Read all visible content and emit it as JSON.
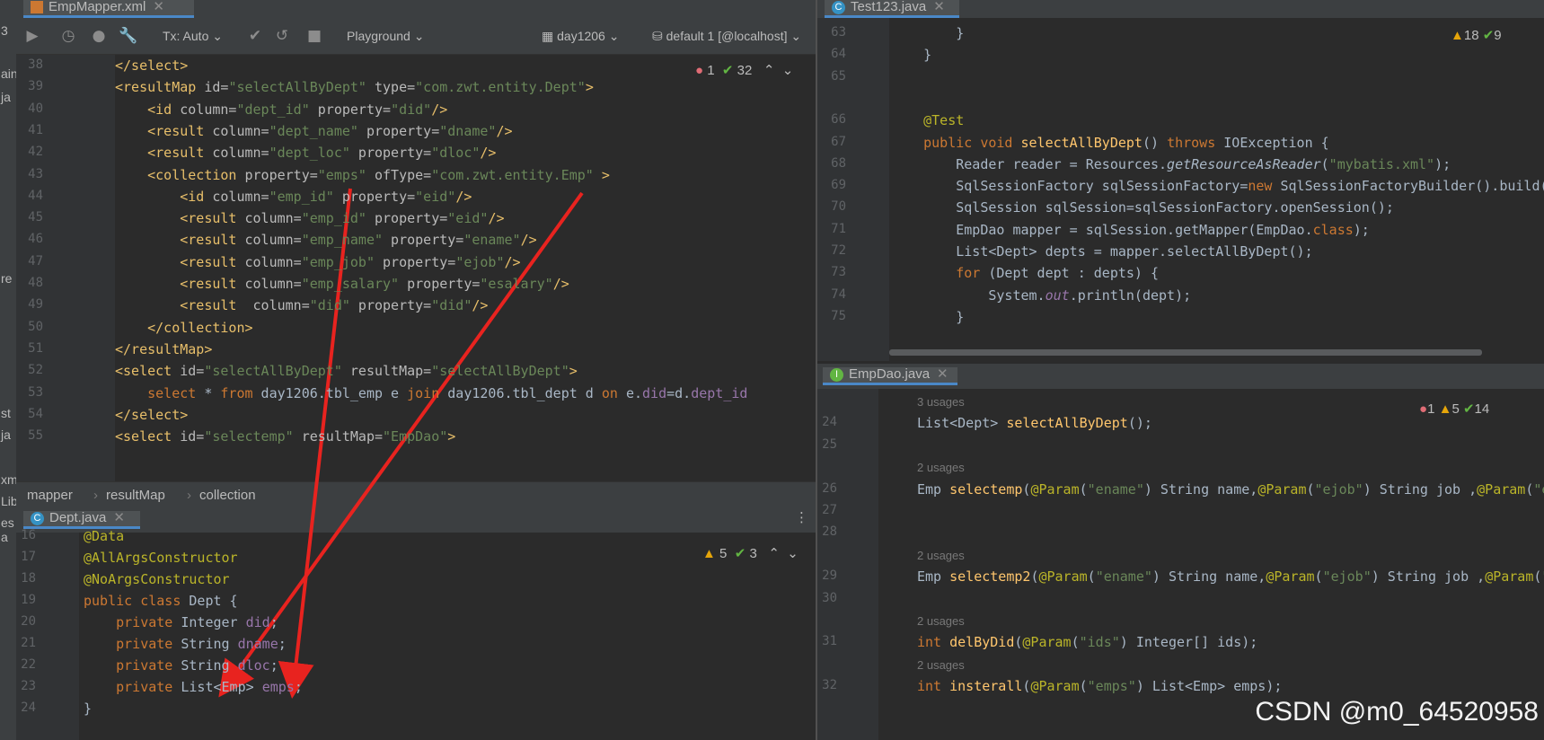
{
  "left_strip": {
    "fragments": [
      "3",
      "ain",
      "ja",
      "re",
      "st",
      "ja",
      "xm",
      "Lib",
      "es a"
    ]
  },
  "xml_editor": {
    "tab": {
      "label": "EmpMapper.xml"
    },
    "toolbar": {
      "tx": "Tx: Auto",
      "playground": "Playground",
      "schema": "day1206",
      "datasource": "default 1 [@localhost]"
    },
    "inspections": {
      "errors": "1",
      "ok": "32"
    },
    "lines": [
      {
        "n": "38",
        "html": "<span class='tag'>&lt;/select&gt;</span>"
      },
      {
        "n": "39",
        "html": "<span class='tag'>&lt;resultMap </span><span class='attr'>id=</span><span class='str'>\"selectAllByDept\"</span><span class='attr'> type=</span><span class='str'>\"com.zwt.entity.Dept\"</span><span class='tag'>&gt;</span>"
      },
      {
        "n": "40",
        "html": "    <span class='tag'>&lt;id </span><span class='attr'>column=</span><span class='str'>\"dept_id\"</span><span class='attr'> property=</span><span class='str'>\"did\"</span><span class='tag'>/&gt;</span>"
      },
      {
        "n": "41",
        "html": "    <span class='tag'>&lt;result </span><span class='attr'>column=</span><span class='str'>\"dept_name\"</span><span class='attr'> property=</span><span class='str'>\"dname\"</span><span class='tag'>/&gt;</span>"
      },
      {
        "n": "42",
        "html": "    <span class='tag'>&lt;result </span><span class='attr'>column=</span><span class='str'>\"dept_loc\"</span><span class='attr'> property=</span><span class='str'>\"dloc\"</span><span class='tag'>/&gt;</span>"
      },
      {
        "n": "43",
        "html": "    <span class='tag'>&lt;collection </span><span class='attr'>property=</span><span class='str'>\"emps\"</span><span class='attr'> ofType=</span><span class='str'>\"com.zwt.entity.Emp\"</span><span class='tag'> &gt;</span>"
      },
      {
        "n": "44",
        "html": "        <span class='tag'>&lt;id </span><span class='attr'>column=</span><span class='str'>\"emp_id\"</span><span class='attr'> property=</span><span class='str'>\"eid\"</span><span class='tag'>/&gt;</span>"
      },
      {
        "n": "45",
        "html": "        <span class='tag'>&lt;result </span><span class='attr'>column=</span><span class='str'>\"emp_id\"</span><span class='attr'> property=</span><span class='str'>\"eid\"</span><span class='tag'>/&gt;</span>"
      },
      {
        "n": "46",
        "html": "        <span class='tag'>&lt;result </span><span class='attr'>column=</span><span class='str'>\"emp_name\"</span><span class='attr'> property=</span><span class='str'>\"ename\"</span><span class='tag'>/&gt;</span>"
      },
      {
        "n": "47",
        "html": "        <span class='tag'>&lt;result </span><span class='attr'>column=</span><span class='str'>\"emp_job\"</span><span class='attr'> property=</span><span class='str'>\"ejob\"</span><span class='tag'>/&gt;</span>"
      },
      {
        "n": "48",
        "html": "        <span class='tag'>&lt;result </span><span class='attr'>column=</span><span class='str'>\"emp_salary\"</span><span class='attr'> property=</span><span class='str'>\"esalary\"</span><span class='tag'>/&gt;</span>"
      },
      {
        "n": "49",
        "html": "        <span class='tag'>&lt;result  </span><span class='attr'>column=</span><span class='str'>\"did\"</span><span class='attr'> property=</span><span class='str'>\"did\"</span><span class='tag'>/&gt;</span>"
      },
      {
        "n": "50",
        "html": "    <span class='tag'>&lt;/collection&gt;</span>"
      },
      {
        "n": "51",
        "html": "<span class='tag'>&lt;/resultMap&gt;</span>"
      },
      {
        "n": "52",
        "html": "<span class='tag'>&lt;select </span><span class='attr'>id=</span><span class='str'>\"selectAllByDept\"</span><span class='attr'> resultMap=</span><span class='str'>\"selectAllByDept\"</span><span class='tag'>&gt;</span>"
      },
      {
        "n": "53",
        "html": "    <span class='kw'>select</span> * <span class='kw'>from</span> day1206.tbl_emp e <span class='kw'>join</span> day1206.tbl_dept d <span class='kw'>on</span> e.<span class='fld'>did</span>=d.<span class='fld'>dept_id</span>"
      },
      {
        "n": "54",
        "html": "<span class='tag'>&lt;/select&gt;</span>"
      },
      {
        "n": "55",
        "html": "<span class='tag'>&lt;select </span><span class='attr'>id=</span><span class='str'>\"selectemp\"</span><span class='attr'> resultMap=</span><span class='str'>\"EmpDao\"</span><span class='tag'>&gt;</span>"
      }
    ],
    "breadcrumb": [
      "mapper",
      "resultMap",
      "collection"
    ]
  },
  "dept_editor": {
    "tab": {
      "label": "Dept.java"
    },
    "inspections": {
      "warnings": "5",
      "ok": "3"
    },
    "lines": [
      {
        "n": "16",
        "html": "<span class='anno'>@Data</span>"
      },
      {
        "n": "17",
        "html": "<span class='anno'>@AllArgsConstructor</span>"
      },
      {
        "n": "18",
        "html": "<span class='anno'>@NoArgsConstructor</span>"
      },
      {
        "n": "19",
        "html": "<span class='kw'>public class </span>Dept {"
      },
      {
        "n": "20",
        "html": "    <span class='kw'>private </span>Integer <span class='fld'>did</span>;"
      },
      {
        "n": "21",
        "html": "    <span class='kw'>private </span>String <span class='fld'>dname</span>;"
      },
      {
        "n": "22",
        "html": "    <span class='kw'>private </span>String <span class='fld'>dloc</span>;"
      },
      {
        "n": "23",
        "html": "    <span class='kw'>private </span>List&lt;Emp&gt; <span class='fld'>emps</span>;"
      },
      {
        "n": "24",
        "html": "}"
      }
    ]
  },
  "test_editor": {
    "tab": {
      "label": "Test123.java"
    },
    "inspections": {
      "warnings": "18",
      "ok": "9"
    },
    "lines": [
      {
        "n": "63",
        "html": "        }"
      },
      {
        "n": "64",
        "html": "    }"
      },
      {
        "n": "65",
        "html": ""
      },
      {
        "n": "",
        "html": ""
      },
      {
        "n": "66",
        "html": "    <span class='anno'>@Test</span>"
      },
      {
        "n": "67",
        "html": "    <span class='kw'>public void </span><span class='fn'>selectAllByDept</span>() <span class='kw'>throws </span>IOException {"
      },
      {
        "n": "68",
        "html": "        Reader reader = Resources.<i>getResourceAsReader</i>(<span class='str'>\"mybatis.xml\"</span>);"
      },
      {
        "n": "69",
        "html": "        SqlSessionFactory sqlSessionFactory=<span class='kw'>new </span>SqlSessionFactoryBuilder().build("
      },
      {
        "n": "70",
        "html": "        SqlSession sqlSession=sqlSessionFactory.openSession();"
      },
      {
        "n": "71",
        "html": "        EmpDao mapper = sqlSession.getMapper(EmpDao.<span class='kw'>class</span>);"
      },
      {
        "n": "72",
        "html": "        List&lt;Dept&gt; depts = mapper.selectAllByDept();"
      },
      {
        "n": "73",
        "html": "        <span class='kw'>for </span>(Dept dept : depts) {"
      },
      {
        "n": "74",
        "html": "            System.<i class='fld'>out</i>.println(dept);"
      },
      {
        "n": "75",
        "html": "        }"
      }
    ]
  },
  "empdao_editor": {
    "tab": {
      "label": "EmpDao.java"
    },
    "inspections": {
      "errors": "1",
      "warnings": "5",
      "ok": "14"
    },
    "lines": [
      {
        "n": "",
        "usage": "3 usages",
        "html": ""
      },
      {
        "n": "24",
        "usage": "",
        "html": "List&lt;Dept&gt; <span class='fn'>selectAllByDept</span>();"
      },
      {
        "n": "25",
        "usage": "",
        "html": ""
      },
      {
        "n": "",
        "usage": "2 usages",
        "html": ""
      },
      {
        "n": "26",
        "usage": "",
        "html": "Emp <span class='fn'>selectemp</span>(<span class='anno'>@Param</span>(<span class='str'>\"ename\"</span>) String name,<span class='anno'>@Param</span>(<span class='str'>\"ejob\"</span>) String job ,<span class='anno'>@Param</span>(<span class='str'>\"e</span>"
      },
      {
        "n": "27",
        "usage": "",
        "html": ""
      },
      {
        "n": "28",
        "usage": "",
        "html": ""
      },
      {
        "n": "",
        "usage": "2 usages",
        "html": ""
      },
      {
        "n": "29",
        "usage": "",
        "html": "Emp <span class='fn'>selectemp2</span>(<span class='anno'>@Param</span>(<span class='str'>\"ename\"</span>) String name,<span class='anno'>@Param</span>(<span class='str'>\"ejob\"</span>) String job ,<span class='anno'>@Param</span>(<span class='str'>\"</span>"
      },
      {
        "n": "30",
        "usage": "",
        "html": ""
      },
      {
        "n": "",
        "usage": "2 usages",
        "html": ""
      },
      {
        "n": "31",
        "usage": "",
        "html": "<span class='kw'>int </span><span class='fn'>delByDid</span>(<span class='anno'>@Param</span>(<span class='str'>\"ids\"</span>) Integer[] ids);"
      },
      {
        "n": "",
        "usage": "2 usages",
        "html": ""
      },
      {
        "n": "32",
        "usage": "",
        "html": "<span class='kw'>int </span><span class='fn'>insterall</span>(<span class='anno'>@Param</span>(<span class='str'>\"emps\"</span>) List&lt;Emp&gt; emps);"
      }
    ]
  },
  "watermark": "CSDN @m0_64520958",
  "colors": {
    "arrow": "#e8231f",
    "accent": "#4a88c7"
  }
}
